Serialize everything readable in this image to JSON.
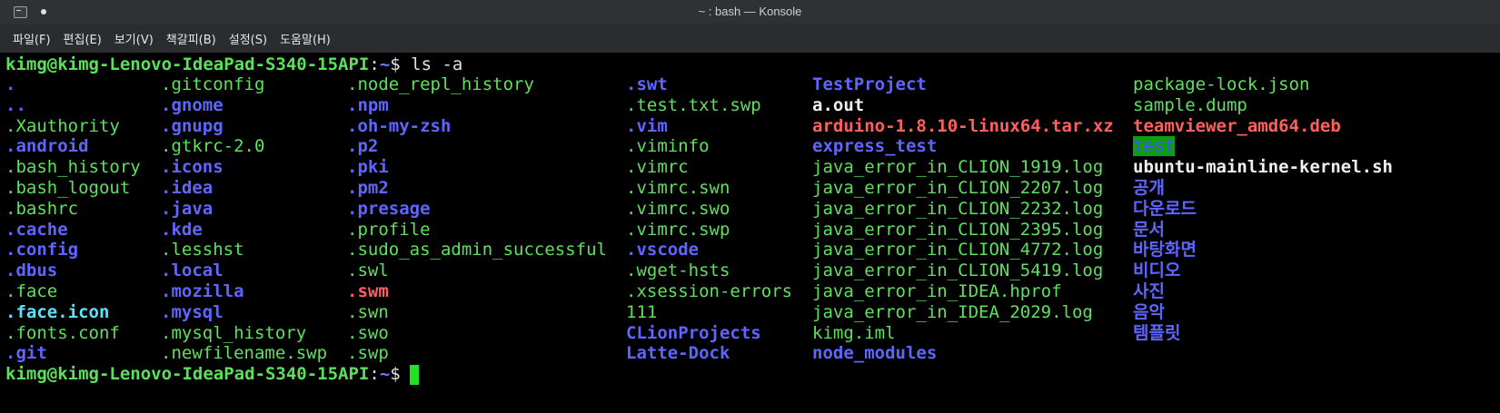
{
  "window": {
    "title": "~ : bash — Konsole",
    "icon": "terminal-icon"
  },
  "menu": [
    "파일(F)",
    "편집(E)",
    "보기(V)",
    "책갈피(B)",
    "설정(S)",
    "도움말(H)"
  ],
  "prompt": {
    "user_host": "kimg@kimg-Lenovo-IdeaPad-S340-15API",
    "sep": ":",
    "path": "~",
    "dollar": "$ ",
    "command": "ls -a"
  },
  "colors": {
    "directory": "#5f66ff",
    "file": "#5fe05f",
    "executable": "#f0f0f0",
    "archive": "#ff5f5f",
    "symlink": "#5fe0ff",
    "cursor": "#22e022"
  },
  "listing": {
    "columns": [
      [
        {
          "name": ".",
          "type": "dir"
        },
        {
          "name": "..",
          "type": "dir"
        },
        {
          "name": ".Xauthority",
          "type": "file"
        },
        {
          "name": ".android",
          "type": "dir"
        },
        {
          "name": ".bash_history",
          "type": "file"
        },
        {
          "name": ".bash_logout",
          "type": "file"
        },
        {
          "name": ".bashrc",
          "type": "file"
        },
        {
          "name": ".cache",
          "type": "dir"
        },
        {
          "name": ".config",
          "type": "dir"
        },
        {
          "name": ".dbus",
          "type": "dir"
        },
        {
          "name": ".face",
          "type": "file"
        },
        {
          "name": ".face.icon",
          "type": "link"
        },
        {
          "name": ".fonts.conf",
          "type": "file"
        },
        {
          "name": ".git",
          "type": "dir"
        }
      ],
      [
        {
          "name": ".gitconfig",
          "type": "file"
        },
        {
          "name": ".gnome",
          "type": "dir"
        },
        {
          "name": ".gnupg",
          "type": "dir"
        },
        {
          "name": ".gtkrc-2.0",
          "type": "file"
        },
        {
          "name": ".icons",
          "type": "dir"
        },
        {
          "name": ".idea",
          "type": "dir"
        },
        {
          "name": ".java",
          "type": "dir"
        },
        {
          "name": ".kde",
          "type": "dir"
        },
        {
          "name": ".lesshst",
          "type": "file"
        },
        {
          "name": ".local",
          "type": "dir"
        },
        {
          "name": ".mozilla",
          "type": "dir"
        },
        {
          "name": ".mysql",
          "type": "dir"
        },
        {
          "name": ".mysql_history",
          "type": "file"
        },
        {
          "name": ".newfilename.swp",
          "type": "file"
        }
      ],
      [
        {
          "name": ".node_repl_history",
          "type": "file"
        },
        {
          "name": ".npm",
          "type": "dir"
        },
        {
          "name": ".oh-my-zsh",
          "type": "dir"
        },
        {
          "name": ".p2",
          "type": "dir"
        },
        {
          "name": ".pki",
          "type": "dir"
        },
        {
          "name": ".pm2",
          "type": "dir"
        },
        {
          "name": ".presage",
          "type": "dir"
        },
        {
          "name": ".profile",
          "type": "file"
        },
        {
          "name": ".sudo_as_admin_successful",
          "type": "file"
        },
        {
          "name": ".swl",
          "type": "file"
        },
        {
          "name": ".swm",
          "type": "archive"
        },
        {
          "name": ".swn",
          "type": "file"
        },
        {
          "name": ".swo",
          "type": "file"
        },
        {
          "name": ".swp",
          "type": "file"
        }
      ],
      [
        {
          "name": ".swt",
          "type": "dir"
        },
        {
          "name": ".test.txt.swp",
          "type": "file"
        },
        {
          "name": ".vim",
          "type": "dir"
        },
        {
          "name": ".viminfo",
          "type": "file"
        },
        {
          "name": ".vimrc",
          "type": "file"
        },
        {
          "name": ".vimrc.swn",
          "type": "file"
        },
        {
          "name": ".vimrc.swo",
          "type": "file"
        },
        {
          "name": ".vimrc.swp",
          "type": "file"
        },
        {
          "name": ".vscode",
          "type": "dir"
        },
        {
          "name": ".wget-hsts",
          "type": "file"
        },
        {
          "name": ".xsession-errors",
          "type": "file"
        },
        {
          "name": "111",
          "type": "file"
        },
        {
          "name": "CLionProjects",
          "type": "dir"
        },
        {
          "name": "Latte-Dock",
          "type": "dir"
        }
      ],
      [
        {
          "name": "TestProject",
          "type": "dir"
        },
        {
          "name": "a.out",
          "type": "exec"
        },
        {
          "name": "arduino-1.8.10-linux64.tar.xz",
          "type": "archive"
        },
        {
          "name": "express_test",
          "type": "dir"
        },
        {
          "name": "java_error_in_CLION_1919.log",
          "type": "file"
        },
        {
          "name": "java_error_in_CLION_2207.log",
          "type": "file"
        },
        {
          "name": "java_error_in_CLION_2232.log",
          "type": "file"
        },
        {
          "name": "java_error_in_CLION_2395.log",
          "type": "file"
        },
        {
          "name": "java_error_in_CLION_4772.log",
          "type": "file"
        },
        {
          "name": "java_error_in_CLION_5419.log",
          "type": "file"
        },
        {
          "name": "java_error_in_IDEA.hprof",
          "type": "file"
        },
        {
          "name": "java_error_in_IDEA_2029.log",
          "type": "file"
        },
        {
          "name": "kimg.iml",
          "type": "file"
        },
        {
          "name": "node_modules",
          "type": "dir"
        }
      ],
      [
        {
          "name": "package-lock.json",
          "type": "file"
        },
        {
          "name": "sample.dump",
          "type": "file"
        },
        {
          "name": "teamviewer_amd64.deb",
          "type": "archive"
        },
        {
          "name": "test",
          "type": "highlight"
        },
        {
          "name": "ubuntu-mainline-kernel.sh",
          "type": "exec"
        },
        {
          "name": "공개",
          "type": "dir"
        },
        {
          "name": "다운로드",
          "type": "dir"
        },
        {
          "name": "문서",
          "type": "dir"
        },
        {
          "name": "바탕화면",
          "type": "dir"
        },
        {
          "name": "비디오",
          "type": "dir"
        },
        {
          "name": "사진",
          "type": "dir"
        },
        {
          "name": "음악",
          "type": "dir"
        },
        {
          "name": "템플릿",
          "type": "dir"
        }
      ]
    ]
  }
}
